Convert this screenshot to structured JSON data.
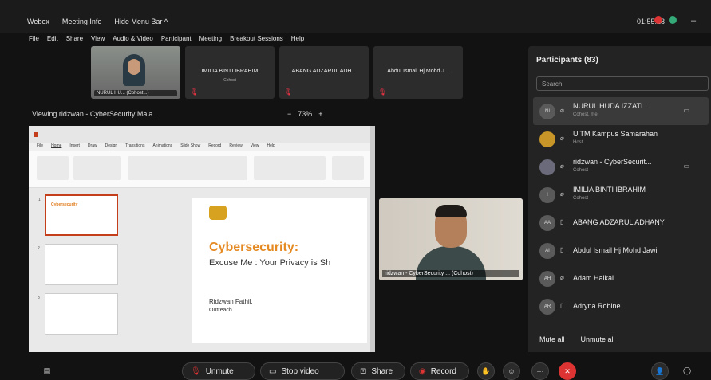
{
  "app": {
    "brand": "Webex",
    "meeting_info": "Meeting Info",
    "hide_menu": "Hide Menu Bar ^",
    "clock": "01:55:28"
  },
  "menu": [
    "File",
    "Edit",
    "Share",
    "View",
    "Audio & Video",
    "Participant",
    "Meeting",
    "Breakout Sessions",
    "Help"
  ],
  "tiles": [
    {
      "name": "NURUL HU... (Cohost...)",
      "photo": true
    },
    {
      "name": "IMILIA BINTI IBRAHIM",
      "sub": "Cohost"
    },
    {
      "name": "ABANG ADZARUL ADH...",
      "sub": ""
    },
    {
      "name": "Abdul Ismail Hj Mohd J...",
      "sub": ""
    }
  ],
  "share": {
    "viewing": "Viewing ridzwan - CyberSecurity Mala...",
    "zoom": "73%",
    "zoom_minus": "−",
    "zoom_plus": "+"
  },
  "slide": {
    "title": "Cybersecurity:",
    "subtitle": "Excuse Me : Your Privacy is Sh",
    "presenter": "Ridzwan Fathil,",
    "dept": "Outreach",
    "menu": [
      "File",
      "Home",
      "Insert",
      "Draw",
      "Design",
      "Transitions",
      "Animations",
      "Slide Show",
      "Record",
      "Review",
      "View",
      "Help"
    ]
  },
  "speaker": {
    "label": "ridzwan - CyberSecurity ... (Cohost)"
  },
  "participants": {
    "header": "Participants (83)",
    "search_placeholder": "Search",
    "list": [
      {
        "initials": "NI",
        "name": "NURUL HUDA IZZATI ...",
        "sub": "Cohost, me"
      },
      {
        "initials": "",
        "name": "UiTM Kampus Samarahan",
        "sub": "Host"
      },
      {
        "initials": "",
        "name": "ridzwan - CyberSecurit...",
        "sub": "Cohost"
      },
      {
        "initials": "I",
        "name": "IMILIA BINTI IBRAHIM",
        "sub": "Cohost"
      },
      {
        "initials": "AA",
        "name": "ABANG ADZARUL ADHANY",
        "sub": ""
      },
      {
        "initials": "AI",
        "name": "Abdul Ismail Hj Mohd Jawi",
        "sub": ""
      },
      {
        "initials": "AH",
        "name": "Adam Haikal",
        "sub": ""
      },
      {
        "initials": "AR",
        "name": "Adryna Robine",
        "sub": ""
      }
    ],
    "mute_all": "Mute all",
    "unmute_all": "Unmute all"
  },
  "controls": {
    "unmute": "Unmute",
    "stop_video": "Stop video",
    "share": "Share",
    "record": "Record",
    "more": "···"
  },
  "colors": {
    "accent_red": "#dd3333",
    "slide_orange": "#e58a22"
  }
}
